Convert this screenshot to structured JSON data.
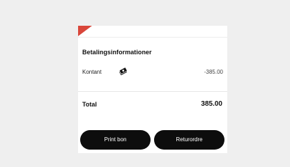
{
  "colors": {
    "page_background": "#efefef",
    "card_background": "#ffffff",
    "accent_red": "#d9463a",
    "button_background": "#0d0d0d",
    "button_text": "#ffffff"
  },
  "payment_info": {
    "title": "Betalingsinformationer",
    "rows": [
      {
        "method": "Kontant",
        "icon": "cash-icon",
        "amount": "-385.00"
      }
    ]
  },
  "total": {
    "label": "Total",
    "value": "385.00"
  },
  "actions": {
    "print_label": "Print bon",
    "return_label": "Returordre"
  }
}
